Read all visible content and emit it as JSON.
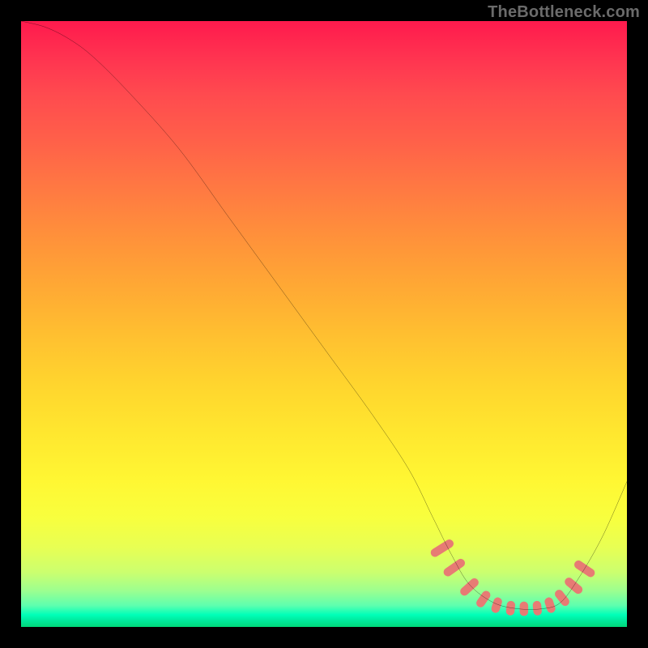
{
  "watermark": {
    "text": "TheBottleneck.com"
  },
  "chart_data": {
    "type": "line",
    "title": "",
    "xlabel": "",
    "ylabel": "",
    "xlim": [
      0,
      100
    ],
    "ylim": [
      0,
      100
    ],
    "grid": false,
    "legend": false,
    "series": [
      {
        "name": "bottleneck-curve",
        "color": "#000000",
        "x": [
          0,
          4,
          8,
          12,
          18,
          26,
          34,
          42,
          50,
          58,
          64,
          68,
          71,
          74,
          78,
          82,
          86,
          89,
          92,
          96,
          100
        ],
        "y": [
          100,
          99,
          97,
          94,
          88,
          79,
          68,
          57,
          46,
          35,
          26,
          18,
          12,
          7,
          4,
          3,
          3,
          4,
          8,
          15,
          24
        ]
      }
    ],
    "markers": {
      "name": "highlight-range",
      "shape": "rounded-rect",
      "color": "#e77b74",
      "points": [
        {
          "x": 69.5,
          "y": 13.0,
          "w": 1.4,
          "h": 4.2,
          "rot": 58
        },
        {
          "x": 71.5,
          "y": 9.8,
          "w": 1.4,
          "h": 4.0,
          "rot": 55
        },
        {
          "x": 74.0,
          "y": 6.6,
          "w": 1.4,
          "h": 3.6,
          "rot": 48
        },
        {
          "x": 76.3,
          "y": 4.6,
          "w": 1.4,
          "h": 3.0,
          "rot": 35
        },
        {
          "x": 78.5,
          "y": 3.6,
          "w": 1.4,
          "h": 2.6,
          "rot": 18
        },
        {
          "x": 80.8,
          "y": 3.1,
          "w": 1.4,
          "h": 2.4,
          "rot": 6
        },
        {
          "x": 83.0,
          "y": 3.0,
          "w": 1.4,
          "h": 2.4,
          "rot": 0
        },
        {
          "x": 85.2,
          "y": 3.1,
          "w": 1.4,
          "h": 2.4,
          "rot": -6
        },
        {
          "x": 87.3,
          "y": 3.6,
          "w": 1.4,
          "h": 2.6,
          "rot": -18
        },
        {
          "x": 89.3,
          "y": 4.8,
          "w": 1.4,
          "h": 3.0,
          "rot": -38
        },
        {
          "x": 91.2,
          "y": 6.8,
          "w": 1.4,
          "h": 3.4,
          "rot": -50
        },
        {
          "x": 93.0,
          "y": 9.6,
          "w": 1.4,
          "h": 3.8,
          "rot": -56
        }
      ]
    }
  }
}
